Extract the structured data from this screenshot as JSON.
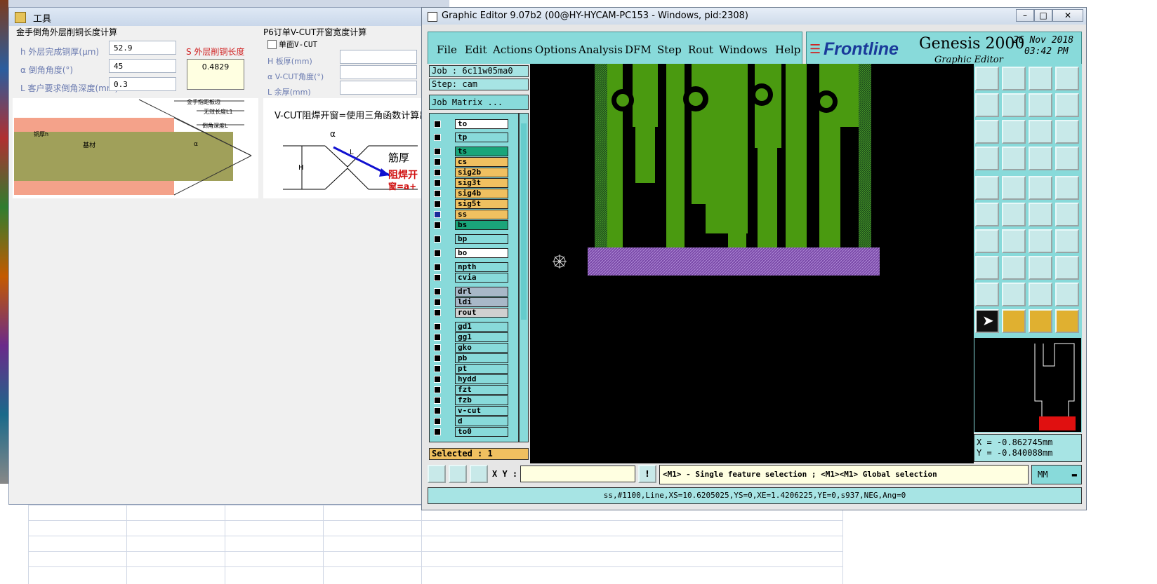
{
  "tool_window": {
    "title": "工具",
    "section1_title": "金手倒角外层削铜长度计算",
    "section2_title": "P6订单V-CUT开窗宽度计算",
    "field_h_label": "h 外层完成铜厚(μm)",
    "field_h_value": "52.9",
    "field_alpha_label": "α 倒角角度(°)",
    "field_alpha_value": "45",
    "field_l_label": "L 客户要求倒角深度(mm)",
    "field_l_value": "0.3",
    "result_label": "S 外层削铜长度",
    "result_value": "0.4829",
    "checkbox_label": "单面V-CUT",
    "vcut_h_label": "H 板厚(mm)",
    "vcut_alpha_label": "α V-CUT角度(°)",
    "vcut_l_label": "L 余厚(mm)",
    "diag_left_labels": [
      "金手指距板边",
      "无效长度L1",
      "倒角深度L",
      "铜厚h",
      "基材",
      "α"
    ],
    "diag_right_title": "V-CUT阻焊开窗=使用三角函数计算出",
    "diag_right_labels": [
      "α",
      "L",
      "H",
      "筋厚",
      "阻焊开",
      "窗=a+"
    ]
  },
  "genesis": {
    "title": "Graphic Editor 9.07b2 (00@HY-HYCAM-PC153 - Windows, pid:2308)",
    "menus": [
      "File",
      "Edit",
      "Actions",
      "Options",
      "Analysis",
      "DFM",
      "Step",
      "Rout",
      "Windows",
      "Help"
    ],
    "logo_brand": "Frontline",
    "logo_product": "Genesis 2000",
    "logo_subtitle": "Graphic Editor",
    "date": "26 Nov 2018",
    "time": "03:42 PM",
    "job": "Job : 6c11w05ma0",
    "step": "Step: cam",
    "job_matrix": "Job Matrix ...",
    "layers": [
      {
        "name": "to",
        "color": "#ffffff"
      },
      {
        "name": "tp",
        "color": "#88dada"
      },
      {
        "name": "ts",
        "color": "#1aa57a"
      },
      {
        "name": "cs",
        "color": "#f0c060"
      },
      {
        "name": "sig2b",
        "color": "#f0c060"
      },
      {
        "name": "sig3t",
        "color": "#f0c060"
      },
      {
        "name": "sig4b",
        "color": "#f0c060"
      },
      {
        "name": "sig5t",
        "color": "#f0c060"
      },
      {
        "name": "ss",
        "color": "#f0c060"
      },
      {
        "name": "bs",
        "color": "#1aa57a"
      },
      {
        "name": "bp",
        "color": "#88dada"
      },
      {
        "name": "bo",
        "color": "#ffffff"
      },
      {
        "name": "npth",
        "color": "#88dada"
      },
      {
        "name": "cvia",
        "color": "#88dada"
      },
      {
        "name": "drl",
        "color": "#a8b8c8"
      },
      {
        "name": "ldi",
        "color": "#a8b8c8"
      },
      {
        "name": "rout",
        "color": "#d0d0d0"
      },
      {
        "name": "gd1",
        "color": "#88dada"
      },
      {
        "name": "gg1",
        "color": "#88dada"
      },
      {
        "name": "gko",
        "color": "#88dada"
      },
      {
        "name": "pb",
        "color": "#88dada"
      },
      {
        "name": "pt",
        "color": "#88dada"
      },
      {
        "name": "hydd",
        "color": "#88dada"
      },
      {
        "name": "fzt",
        "color": "#88dada"
      },
      {
        "name": "fzb",
        "color": "#88dada"
      },
      {
        "name": "v-cut",
        "color": "#88dada"
      },
      {
        "name": "d",
        "color": "#88dada"
      },
      {
        "name": "to0",
        "color": "#88dada"
      }
    ],
    "selected": "Selected : 1",
    "coord_x": "X = -0.862745mm",
    "coord_y": "Y = -0.840088mm",
    "xy_label": "X Y :",
    "xy_value": "",
    "hint": "<M1> - Single feature selection ; <M1><M1> Global selection",
    "units": "MM",
    "status": "ss,#1100,Line,XS=10.6205025,YS=0,XE=1.4206225,YE=0,s937,NEG,Ang=0"
  }
}
